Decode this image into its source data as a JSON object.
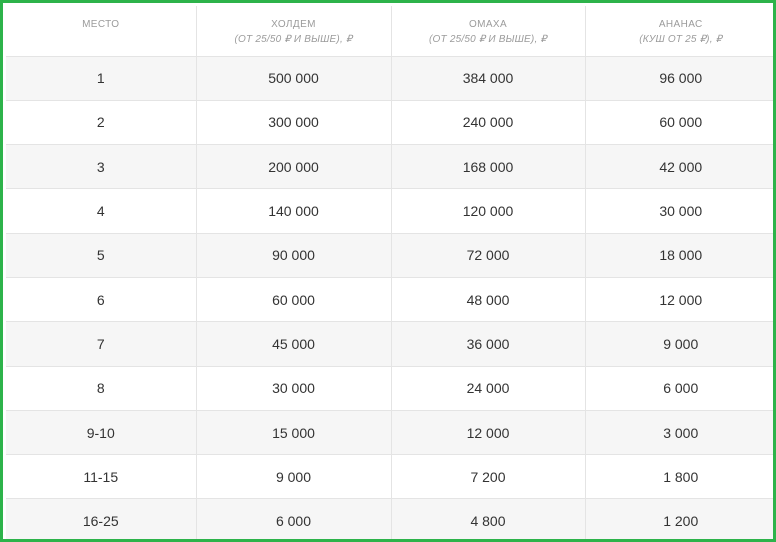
{
  "headers": [
    {
      "title": "МЕСТО",
      "subtitle": ""
    },
    {
      "title": "ХОЛДЕМ",
      "subtitle": "(ОТ 25/50 ₽ И ВЫШЕ), ₽"
    },
    {
      "title": "ОМАХА",
      "subtitle": "(ОТ 25/50 ₽ И ВЫШЕ), ₽"
    },
    {
      "title": "АНАНАС",
      "subtitle": "(КУШ ОТ 25 ₽), ₽"
    }
  ],
  "rows": [
    [
      "1",
      "500 000",
      "384 000",
      "96 000"
    ],
    [
      "2",
      "300 000",
      "240 000",
      "60 000"
    ],
    [
      "3",
      "200 000",
      "168 000",
      "42 000"
    ],
    [
      "4",
      "140 000",
      "120 000",
      "30 000"
    ],
    [
      "5",
      "90 000",
      "72 000",
      "18 000"
    ],
    [
      "6",
      "60 000",
      "48 000",
      "12 000"
    ],
    [
      "7",
      "45 000",
      "36 000",
      "9 000"
    ],
    [
      "8",
      "30 000",
      "24 000",
      "6 000"
    ],
    [
      "9-10",
      "15 000",
      "12 000",
      "3 000"
    ],
    [
      "11-15",
      "9 000",
      "7 200",
      "1 800"
    ],
    [
      "16-25",
      "6 000",
      "4 800",
      "1 200"
    ]
  ],
  "colors": {
    "frame_border": "#2db34a",
    "header_text": "#9b9b9b",
    "cell_text": "#333333",
    "row_alt_bg": "#f6f6f6",
    "grid_line": "#e4e4e4"
  }
}
